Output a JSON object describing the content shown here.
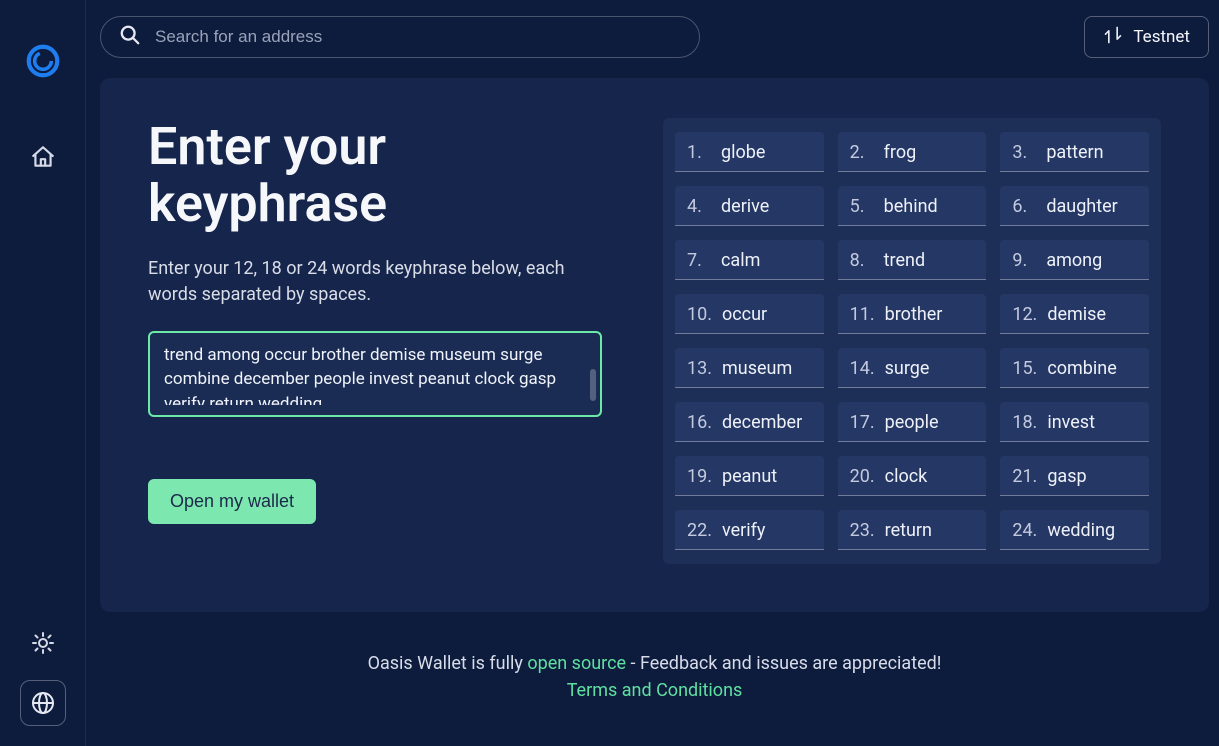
{
  "search": {
    "placeholder": "Search for an address"
  },
  "network": {
    "label": "Testnet"
  },
  "page": {
    "title": "Enter your keyphrase",
    "subtitle": "Enter your 12, 18 or 24 words keyphrase below, each words separated by spaces.",
    "keyphrase_value": "trend among occur brother demise museum surge combine december people invest peanut clock gasp verify return wedding",
    "open_button": "Open my wallet"
  },
  "words": [
    "globe",
    "frog",
    "pattern",
    "derive",
    "behind",
    "daughter",
    "calm",
    "trend",
    "among",
    "occur",
    "brother",
    "demise",
    "museum",
    "surge",
    "combine",
    "december",
    "people",
    "invest",
    "peanut",
    "clock",
    "gasp",
    "verify",
    "return",
    "wedding"
  ],
  "footer": {
    "prefix": "Oasis Wallet is fully ",
    "open_source": "open source",
    "suffix": " - Feedback and issues are appreciated!",
    "terms": "Terms and Conditions"
  }
}
